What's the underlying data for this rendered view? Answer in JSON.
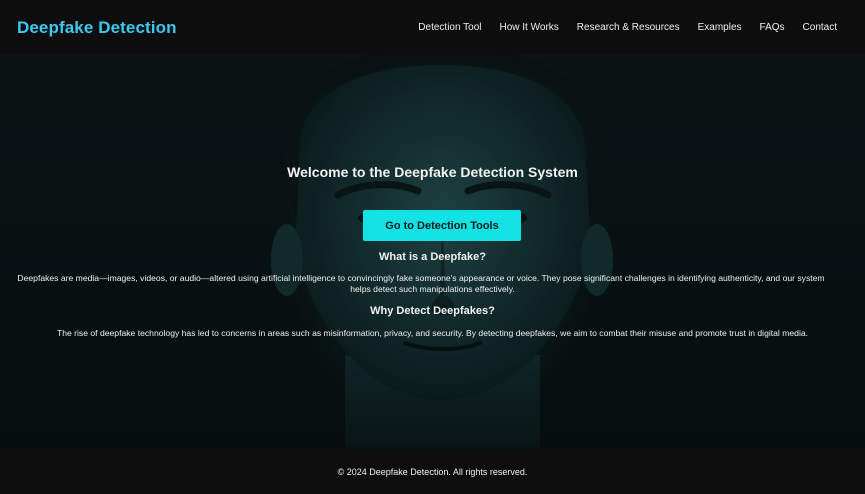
{
  "brand": "Deepfake Detection",
  "nav": {
    "items": [
      "Detection Tool",
      "How It Works",
      "Research & Resources",
      "Examples",
      "FAQs",
      "Contact"
    ]
  },
  "hero": {
    "title": "Welcome to the Deepfake Detection System",
    "cta_label": "Go to Detection Tools",
    "what_heading": "What is a Deepfake?",
    "what_line1": "Deepfakes are media—images, videos, or audio—altered using artificial intelligence to convincingly fake someone's appearance or voice. They pose significant challenges in identifying authenticity, and our system",
    "what_line2": "helps detect such manipulations effectively.",
    "why_heading": "Why Detect Deepfakes?",
    "why_text": "The rise of deepfake technology has led to concerns in areas such as misinformation, privacy, and security. By detecting deepfakes, we aim to combat their misuse and promote trust in digital media."
  },
  "footer": {
    "copyright": "© 2024 Deepfake Detection. All rights reserved."
  },
  "colors": {
    "brand": "#3cc9ef",
    "cta": "#12e2e4",
    "background": "#0b0b0b"
  }
}
